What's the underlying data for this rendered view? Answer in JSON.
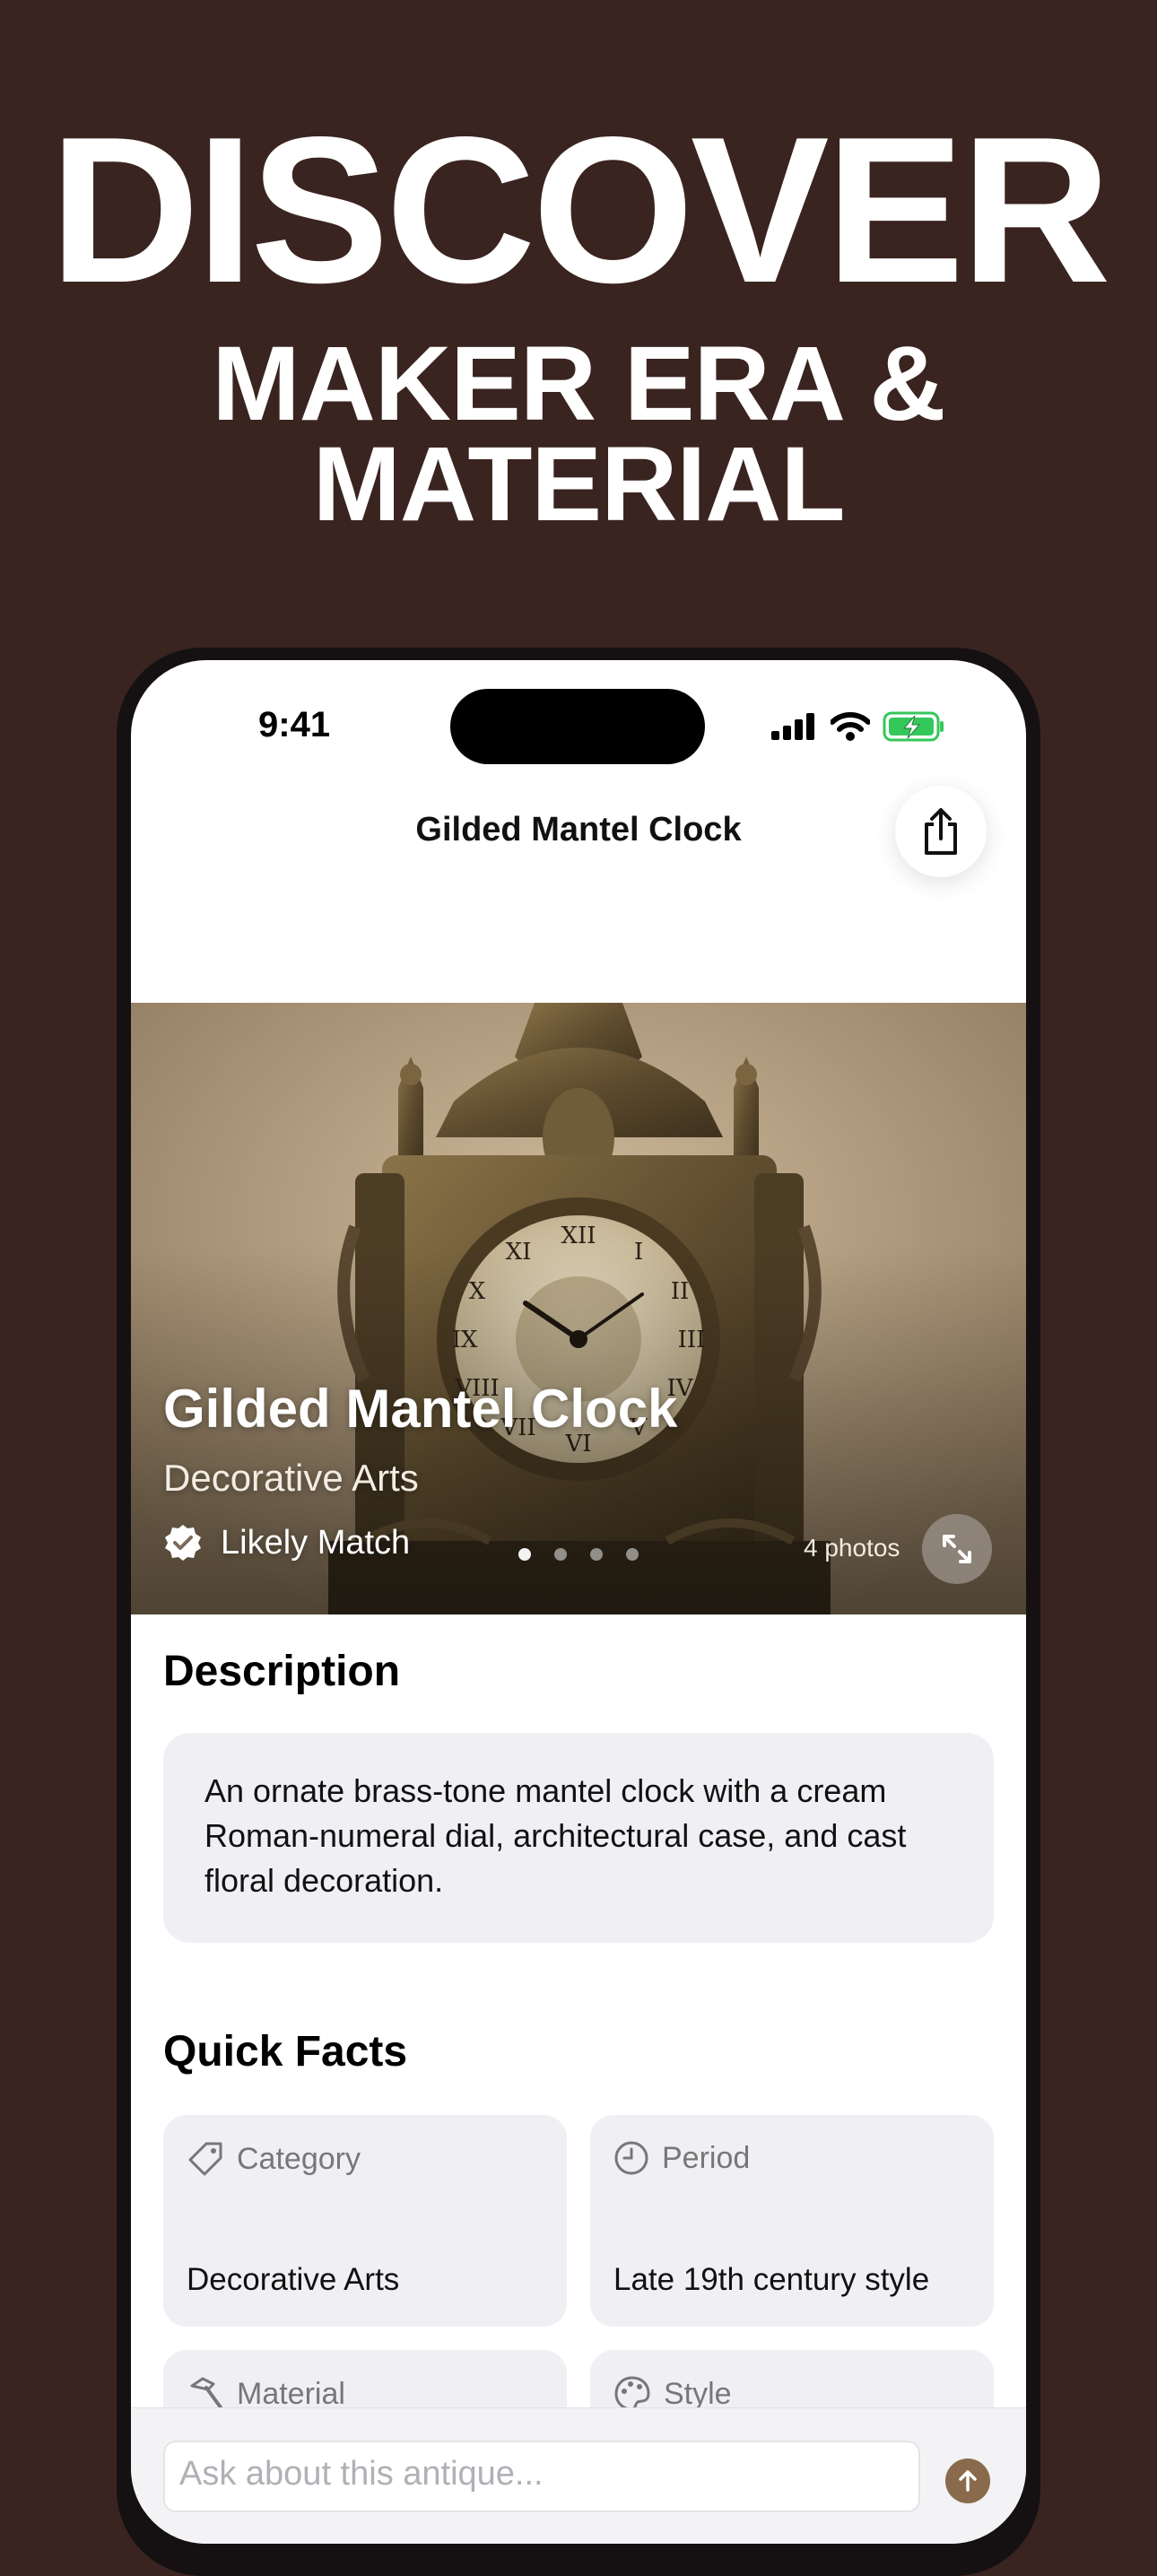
{
  "promo": {
    "headline": "DISCOVER",
    "subline_1": "MAKER ERA &",
    "subline_2": "MATERIAL"
  },
  "status_bar": {
    "time": "9:41"
  },
  "nav": {
    "title": "Gilded Mantel Clock"
  },
  "hero": {
    "title": "Gilded Mantel Clock",
    "category": "Decorative Arts",
    "match_label": "Likely Match",
    "photos_count": "4 photos",
    "page_count": 4,
    "active_page": 1
  },
  "description": {
    "heading": "Description",
    "text": "An ornate brass-tone mantel clock with a cream Roman-numeral dial, architectural case, and cast floral decoration."
  },
  "quick_facts": {
    "heading": "Quick Facts",
    "items": [
      {
        "label": "Category",
        "value": "Decorative Arts",
        "icon": "tag-icon"
      },
      {
        "label": "Period",
        "value": "Late 19th century style",
        "icon": "clock-icon"
      },
      {
        "label": "Material",
        "value": "",
        "icon": "hammer-icon"
      },
      {
        "label": "Style",
        "value": "",
        "icon": "palette-icon"
      }
    ]
  },
  "ask": {
    "placeholder": "Ask about this antique..."
  },
  "colors": {
    "background": "#3a2420",
    "accent": "#8a6a4c",
    "card": "#f0f0f4",
    "battery_green": "#34c759"
  }
}
